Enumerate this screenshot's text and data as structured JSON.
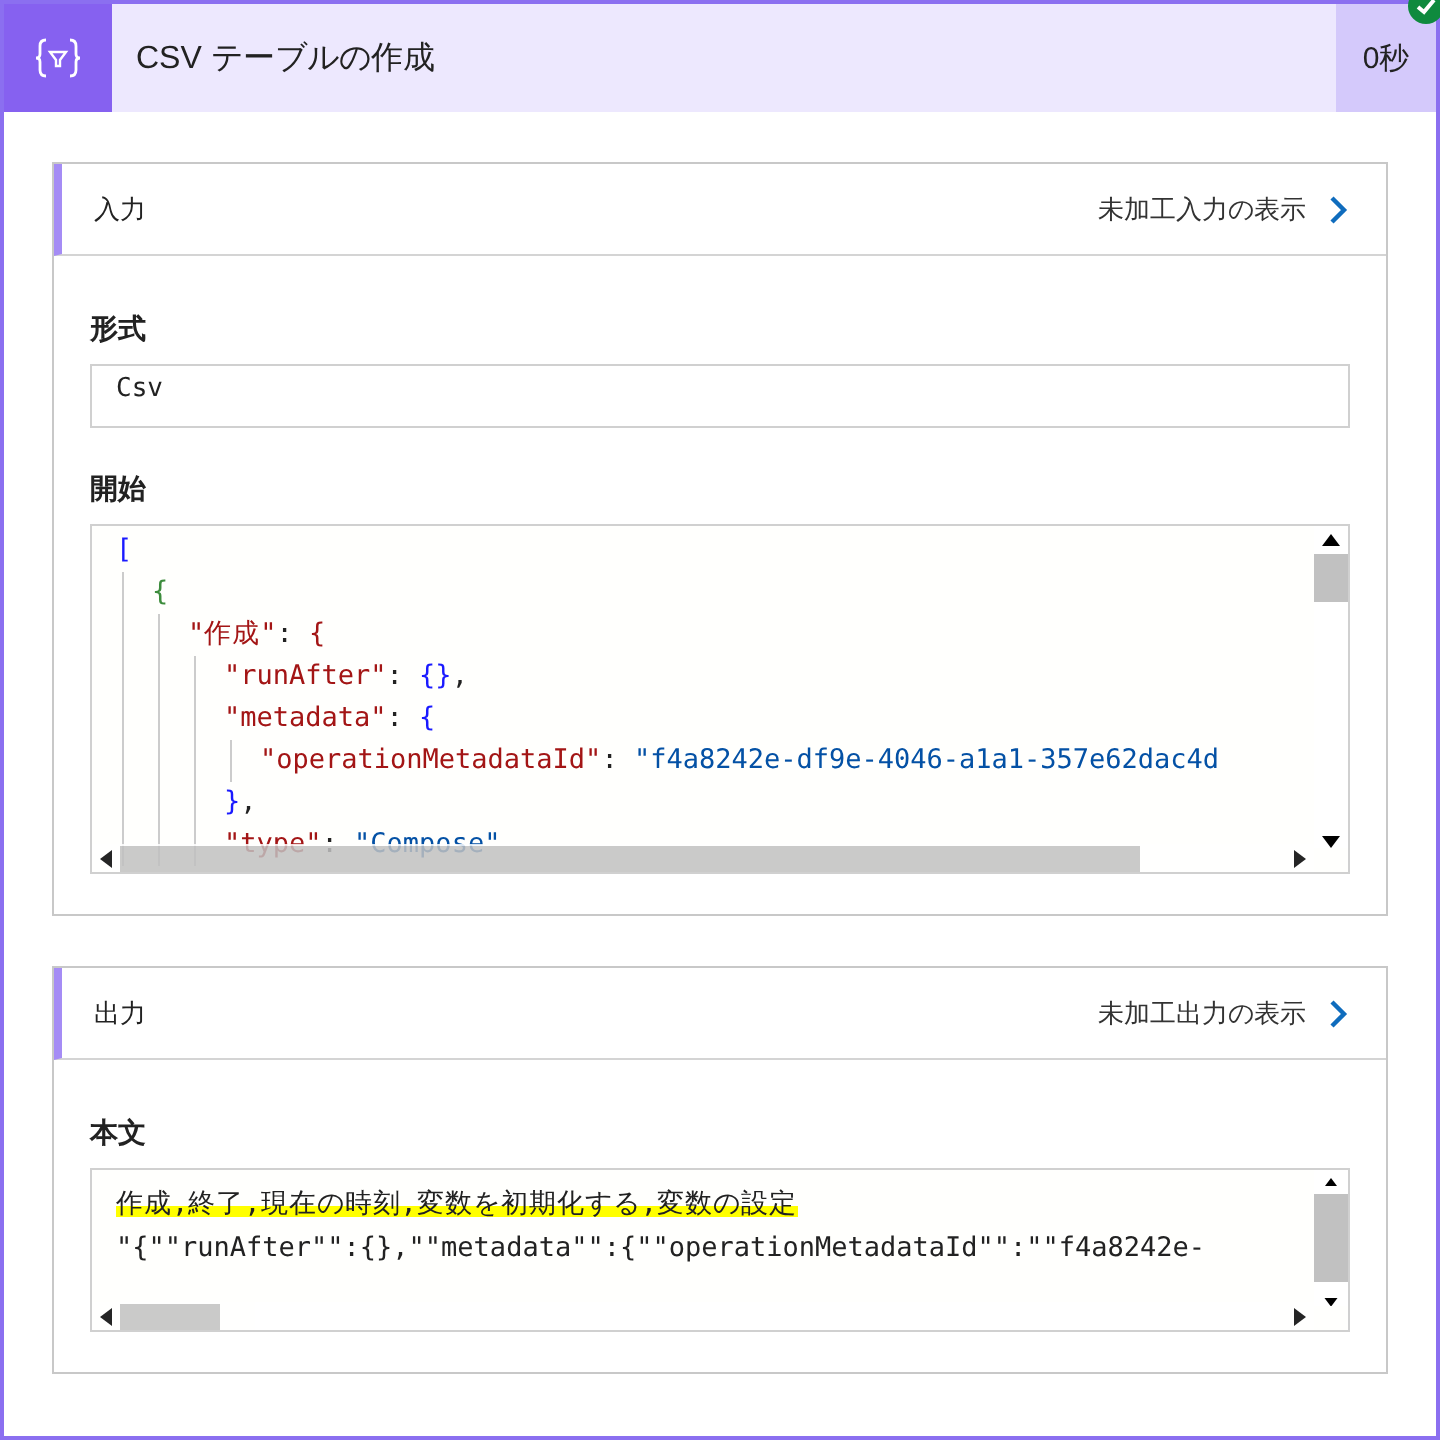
{
  "header": {
    "title": "CSV テーブルの作成",
    "duration": "0秒",
    "succeeded": true
  },
  "sections": [
    {
      "title": "入力",
      "link": "未加工入力の表示",
      "fields": [
        {
          "kind": "text",
          "label": "形式",
          "value": "Csv"
        },
        {
          "kind": "code",
          "label": "開始",
          "lines": [
            {
              "tokens": [
                {
                  "text": "[",
                  "kind": "bracket"
                }
              ],
              "children": [
                {
                  "tokens": [
                    {
                      "text": "{",
                      "kind": "brace"
                    }
                  ],
                  "children": [
                    {
                      "tokens": [
                        {
                          "text": "\"作成\"",
                          "kind": "key"
                        },
                        {
                          "text": ": ",
                          "kind": "plain"
                        },
                        {
                          "text": "{",
                          "kind": "key"
                        }
                      ],
                      "children": [
                        {
                          "tokens": [
                            {
                              "text": "\"runAfter\"",
                              "kind": "key"
                            },
                            {
                              "text": ": ",
                              "kind": "plain"
                            },
                            {
                              "text": "{}",
                              "kind": "bracket"
                            },
                            {
                              "text": ",",
                              "kind": "plain"
                            }
                          ]
                        },
                        {
                          "tokens": [
                            {
                              "text": "\"metadata\"",
                              "kind": "key"
                            },
                            {
                              "text": ": ",
                              "kind": "plain"
                            },
                            {
                              "text": "{",
                              "kind": "bracket"
                            }
                          ],
                          "children": [
                            {
                              "tokens": [
                                {
                                  "text": "\"operationMetadataId\"",
                                  "kind": "key"
                                },
                                {
                                  "text": ": ",
                                  "kind": "plain"
                                },
                                {
                                  "text": "\"f4a8242e-df9e-4046-a1a1-357e62dac4d",
                                  "kind": "string"
                                }
                              ]
                            }
                          ]
                        },
                        {
                          "tokens": [
                            {
                              "text": "}",
                              "kind": "bracket"
                            },
                            {
                              "text": ",",
                              "kind": "plain"
                            }
                          ]
                        },
                        {
                          "tokens": [
                            {
                              "text": "\"type\"",
                              "kind": "key"
                            },
                            {
                              "text": ": ",
                              "kind": "plain"
                            },
                            {
                              "text": "\"Compose\"",
                              "kind": "string"
                            }
                          ]
                        }
                      ]
                    }
                  ]
                }
              ]
            }
          ]
        }
      ]
    },
    {
      "title": "出力",
      "link": "未加工出力の表示",
      "fields": [
        {
          "kind": "csv",
          "label": "本文",
          "lines": [
            {
              "text": "作成,終了,現在の時刻,変数を初期化する,変数の設定",
              "highlighted": true
            },
            {
              "text": "\"{\"\"runAfter\"\":{},\"\"metadata\"\":{\"\"operationMetadataId\"\":\"\"f4a8242e-",
              "highlighted": false
            }
          ]
        }
      ]
    }
  ]
}
